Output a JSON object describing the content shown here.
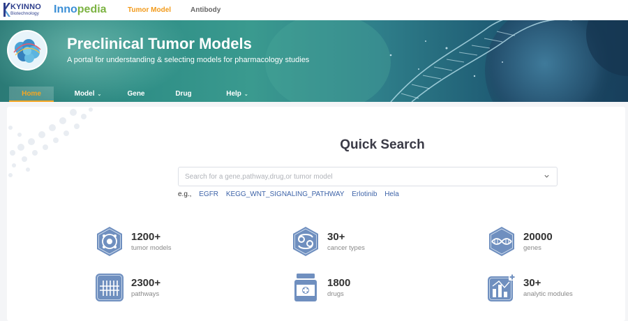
{
  "topbar": {
    "logo_line1": "KYINNO",
    "logo_line2": "Biotechnology",
    "brand_part1": "Inno",
    "brand_part2": "pedia",
    "links": [
      {
        "label": "Tumor Model",
        "active": true
      },
      {
        "label": "Antibody",
        "active": false
      }
    ]
  },
  "banner": {
    "title": "Preclinical Tumor Models",
    "subtitle": "A portal for understanding & selecting models for pharmacology studies"
  },
  "nav": {
    "items": [
      {
        "label": "Home",
        "active": true,
        "dropdown": false
      },
      {
        "label": "Model",
        "active": false,
        "dropdown": true
      },
      {
        "label": "Gene",
        "active": false,
        "dropdown": false
      },
      {
        "label": "Drug",
        "active": false,
        "dropdown": false
      },
      {
        "label": "Help",
        "active": false,
        "dropdown": true
      }
    ]
  },
  "quick_search": {
    "title": "Quick Search",
    "placeholder": "Search for a gene,pathway,drug,or tumor model",
    "value": "",
    "examples_label": "e.g.,",
    "examples": [
      "EGFR",
      "KEGG_WNT_SIGNALING_PATHWAY",
      "Erlotinib",
      "Hela"
    ]
  },
  "stats": [
    {
      "value": "1200+",
      "label": "tumor models",
      "icon": "tumor-cell-icon"
    },
    {
      "value": "30+",
      "label": "cancer types",
      "icon": "cancer-sign-icon"
    },
    {
      "value": "20000",
      "label": "genes",
      "icon": "dna-icon"
    },
    {
      "value": "2300+",
      "label": "pathways",
      "icon": "pathway-icon"
    },
    {
      "value": "1800",
      "label": "drugs",
      "icon": "drug-bottle-icon"
    },
    {
      "value": "30+",
      "label": "analytic modules",
      "icon": "analytics-chart-icon"
    }
  ],
  "colors": {
    "accent": "#f29a1a",
    "brand_blue": "#3b8fd6",
    "brand_green": "#7cb342",
    "link": "#3d63a8",
    "icon_fill": "#6f8fbf"
  }
}
